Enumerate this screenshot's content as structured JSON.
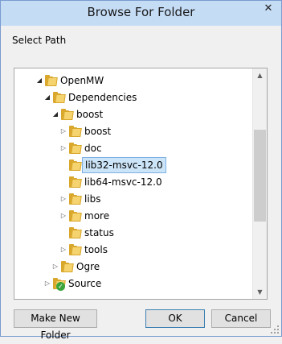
{
  "window": {
    "title": "Browse For Folder",
    "close_glyph": "✕"
  },
  "instruction": "Select Path",
  "tree": {
    "items": [
      {
        "label": "OpenMW",
        "expanded": true,
        "selected": false,
        "icon": "folder-icon"
      },
      {
        "label": "Dependencies",
        "expanded": true,
        "selected": false,
        "icon": "folder-icon"
      },
      {
        "label": "boost",
        "expanded": true,
        "selected": false,
        "icon": "folder-icon"
      },
      {
        "label": "boost",
        "expanded": false,
        "selected": false,
        "icon": "folder-icon"
      },
      {
        "label": "doc",
        "expanded": false,
        "selected": false,
        "icon": "folder-icon"
      },
      {
        "label": "lib32-msvc-12.0",
        "expanded": null,
        "selected": true,
        "icon": "folder-icon"
      },
      {
        "label": "lib64-msvc-12.0",
        "expanded": null,
        "selected": false,
        "icon": "folder-icon"
      },
      {
        "label": "libs",
        "expanded": false,
        "selected": false,
        "icon": "folder-icon"
      },
      {
        "label": "more",
        "expanded": false,
        "selected": false,
        "icon": "folder-icon"
      },
      {
        "label": "status",
        "expanded": null,
        "selected": false,
        "icon": "folder-icon"
      },
      {
        "label": "tools",
        "expanded": false,
        "selected": false,
        "icon": "folder-icon"
      },
      {
        "label": "Ogre",
        "expanded": false,
        "selected": false,
        "icon": "folder-icon"
      },
      {
        "label": "Source",
        "expanded": false,
        "selected": false,
        "icon": "synced-folder-icon"
      }
    ],
    "scroll_fraction": 0.43
  },
  "buttons": {
    "new_folder": "Make New Folder",
    "ok": "OK",
    "cancel": "Cancel"
  }
}
